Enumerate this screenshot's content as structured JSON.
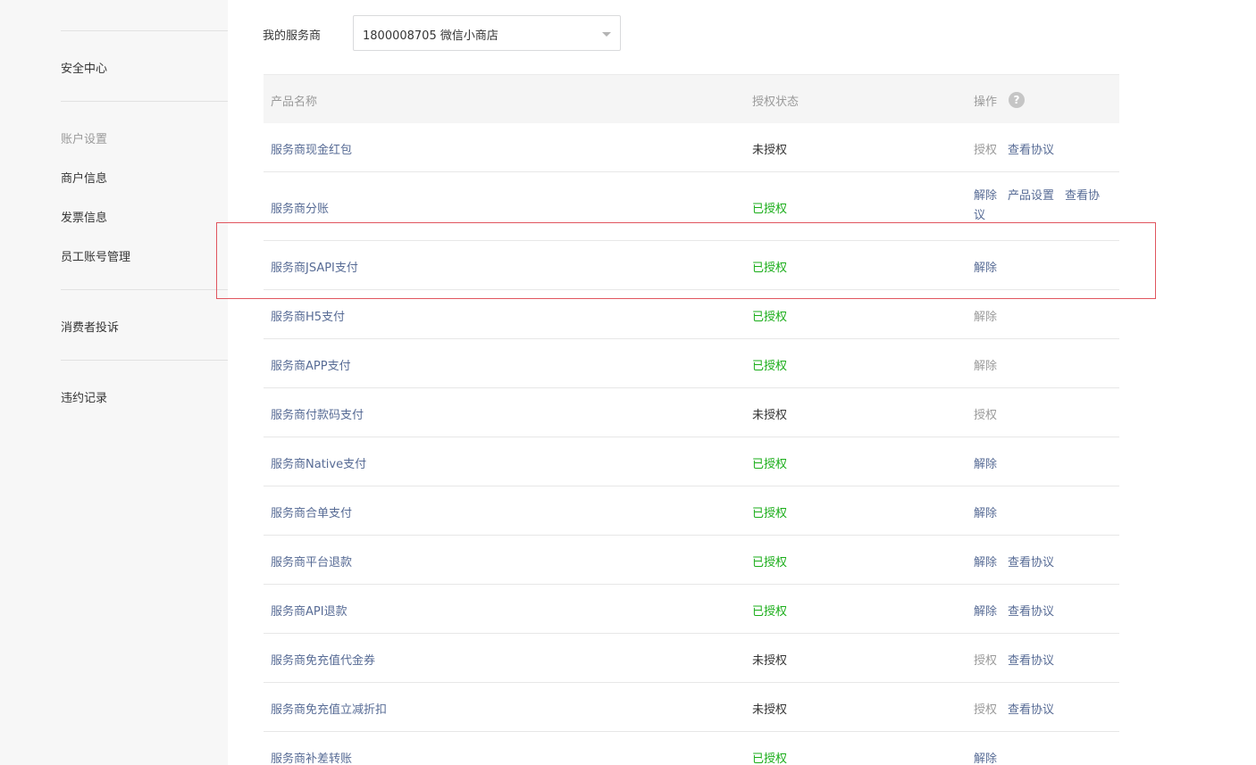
{
  "sidebar": {
    "top_cut_label": "",
    "security_center": "安全中心",
    "account_group_title": "账户设置",
    "merchant_info": "商户信息",
    "invoice_info": "发票信息",
    "staff_accounts": "员工账号管理",
    "consumer_complaints": "消费者投诉",
    "violation_records": "违约记录"
  },
  "service_provider": {
    "label": "我的服务商",
    "selected": "1800008705 微信小商店"
  },
  "table": {
    "headers": {
      "name": "产品名称",
      "status": "授权状态",
      "ops": "操作",
      "help_glyph": "?"
    },
    "rows": [
      {
        "name": "服务商现金红包",
        "status": "未授权",
        "status_color": "gray",
        "ops": [
          {
            "label": "授权",
            "enabled": false
          },
          {
            "label": "查看协议",
            "enabled": true
          }
        ]
      },
      {
        "name": "服务商分账",
        "status": "已授权",
        "status_color": "green",
        "ops": [
          {
            "label": "解除",
            "enabled": true
          },
          {
            "label": "产品设置",
            "enabled": true
          },
          {
            "label": "查看协议",
            "enabled": true
          }
        ]
      },
      {
        "name": "服务商JSAPI支付",
        "status": "已授权",
        "status_color": "green",
        "ops": [
          {
            "label": "解除",
            "enabled": true
          }
        ]
      },
      {
        "name": "服务商H5支付",
        "status": "已授权",
        "status_color": "green",
        "ops": [
          {
            "label": "解除",
            "enabled": false
          }
        ]
      },
      {
        "name": "服务商APP支付",
        "status": "已授权",
        "status_color": "green",
        "ops": [
          {
            "label": "解除",
            "enabled": false
          }
        ]
      },
      {
        "name": "服务商付款码支付",
        "status": "未授权",
        "status_color": "gray",
        "ops": [
          {
            "label": "授权",
            "enabled": false
          }
        ]
      },
      {
        "name": "服务商Native支付",
        "status": "已授权",
        "status_color": "green",
        "ops": [
          {
            "label": "解除",
            "enabled": true
          }
        ]
      },
      {
        "name": "服务商合单支付",
        "status": "已授权",
        "status_color": "green",
        "ops": [
          {
            "label": "解除",
            "enabled": true
          }
        ]
      },
      {
        "name": "服务商平台退款",
        "status": "已授权",
        "status_color": "green",
        "ops": [
          {
            "label": "解除",
            "enabled": true
          },
          {
            "label": "查看协议",
            "enabled": true
          }
        ]
      },
      {
        "name": "服务商API退款",
        "status": "已授权",
        "status_color": "green",
        "ops": [
          {
            "label": "解除",
            "enabled": true
          },
          {
            "label": "查看协议",
            "enabled": true
          }
        ]
      },
      {
        "name": "服务商免充值代金券",
        "status": "未授权",
        "status_color": "gray",
        "ops": [
          {
            "label": "授权",
            "enabled": false
          },
          {
            "label": "查看协议",
            "enabled": true
          }
        ]
      },
      {
        "name": "服务商免充值立减折扣",
        "status": "未授权",
        "status_color": "gray",
        "ops": [
          {
            "label": "授权",
            "enabled": false
          },
          {
            "label": "查看协议",
            "enabled": true
          }
        ]
      },
      {
        "name": "服务商补差转账",
        "status": "已授权",
        "status_color": "green",
        "ops": [
          {
            "label": "解除",
            "enabled": true
          }
        ]
      }
    ]
  },
  "colors": {
    "link": "#576b95",
    "authorized": "#1aad19",
    "disabled": "#9a9a9a",
    "highlight_border": "#e0555e"
  }
}
